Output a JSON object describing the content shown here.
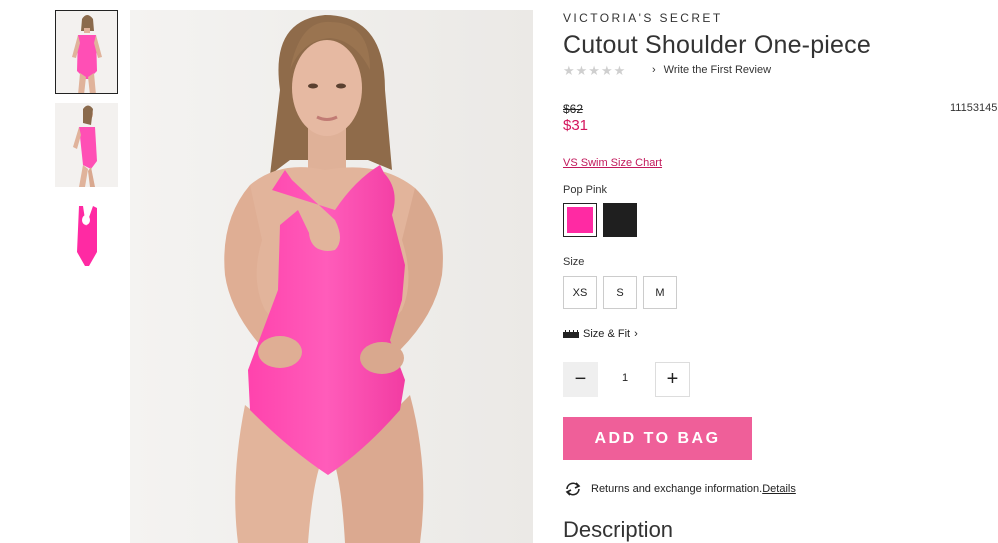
{
  "thumbnails": [
    {
      "alt": "Model front view"
    },
    {
      "alt": "Model side view"
    },
    {
      "alt": "Product flat view"
    }
  ],
  "product": {
    "brand": "VICTORIA'S SECRET",
    "title": "Cutout Shoulder One-piece",
    "rating_stars": "★★★★★",
    "review_link": "Write the First Review",
    "old_price": "$62",
    "new_price": "$31",
    "sku": "11153145",
    "size_chart_link": "VS Swim Size Chart",
    "color_name": "Pop Pink",
    "swatches": [
      {
        "name": "Pop Pink",
        "color": "#ff2aa3",
        "selected": true
      },
      {
        "name": "Black",
        "color": "#1f1f1f",
        "selected": false
      }
    ],
    "size_label": "Size",
    "sizes": [
      "XS",
      "S",
      "M"
    ],
    "size_fit": "Size & Fit",
    "quantity": "1",
    "qty_minus": "−",
    "qty_plus": "+",
    "add_to_bag": "ADD TO BAG",
    "returns_text": "Returns and exchange information.",
    "returns_link": "Details",
    "description_heading": "Description"
  },
  "colors": {
    "accent": "#ef5f99",
    "price": "#d4155d",
    "swimsuit": "#ff4fb5"
  }
}
